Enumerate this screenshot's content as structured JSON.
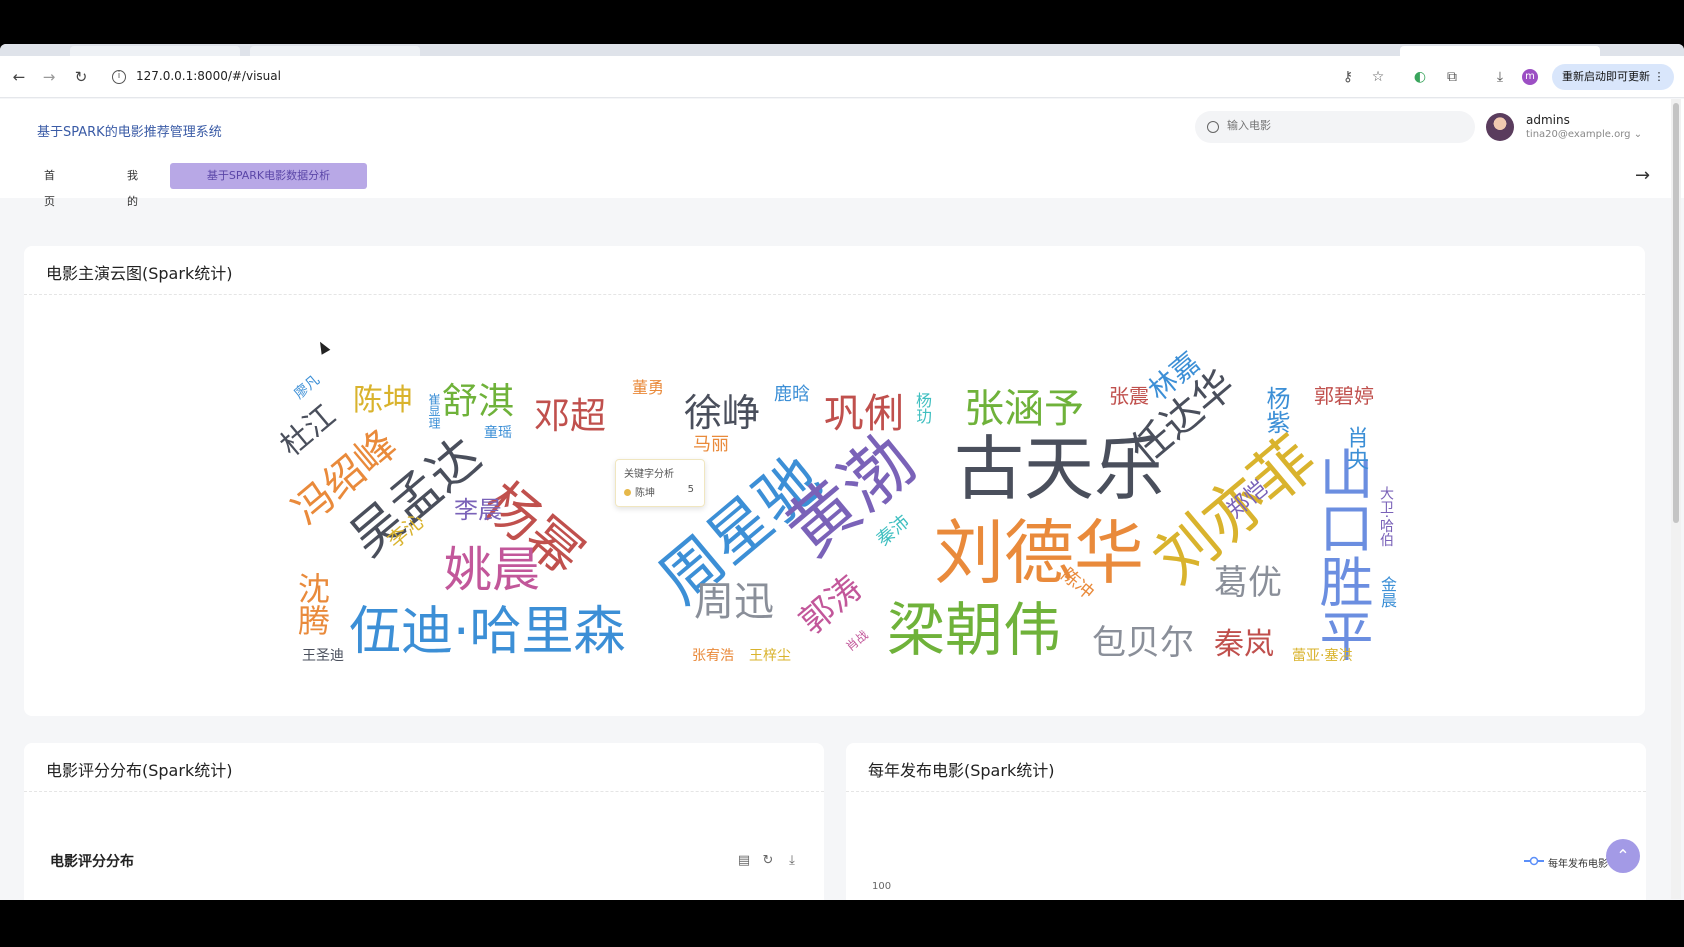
{
  "browser": {
    "url": "127.0.0.1:8000/#/visual",
    "update_label": "重新启动即可更新",
    "profile_initial": "m"
  },
  "app": {
    "title": "基于SPARK的电影推荐管理系统",
    "search_placeholder": "输入电影",
    "user": {
      "name": "admins",
      "email": "tina20@example.org"
    },
    "tabs": [
      {
        "label": "首页"
      },
      {
        "label": "我的"
      },
      {
        "label": "基于SPARK电影数据分析",
        "active": true
      }
    ]
  },
  "cloud_card": {
    "title": "电影主演云图(Spark统计)",
    "words": [
      {
        "text": "古天乐",
        "color": "#4a4f5c"
      },
      {
        "text": "刘德华",
        "color": "#e98a3b"
      },
      {
        "text": "梁朝伟",
        "color": "#6fb23a"
      },
      {
        "text": "周星驰",
        "color": "#3c8fd6"
      },
      {
        "text": "黄渤",
        "color": "#7a62b8"
      },
      {
        "text": "刘亦菲",
        "color": "#d9b32d"
      },
      {
        "text": "山口胜平",
        "color": "#6b8ee0"
      },
      {
        "text": "伍迪·哈里森",
        "color": "#3c8fd6"
      },
      {
        "text": "吴孟达",
        "color": "#4a4f5c"
      },
      {
        "text": "杨幂",
        "color": "#c0504d"
      },
      {
        "text": "姚晨",
        "color": "#c2579a"
      },
      {
        "text": "冯绍峰",
        "color": "#e98a3b"
      },
      {
        "text": "任达华",
        "color": "#4a4f5c"
      },
      {
        "text": "张涵予",
        "color": "#6fb23a"
      },
      {
        "text": "巩俐",
        "color": "#c0504d"
      },
      {
        "text": "徐峥",
        "color": "#4a4f5c"
      },
      {
        "text": "邓超",
        "color": "#c0504d"
      },
      {
        "text": "舒淇",
        "color": "#6fb23a"
      },
      {
        "text": "陈坤",
        "color": "#d9b32d"
      },
      {
        "text": "杜江",
        "color": "#4a4f5c"
      },
      {
        "text": "周迅",
        "color": "#8a8f99"
      },
      {
        "text": "郭涛",
        "color": "#c2579a"
      },
      {
        "text": "葛优",
        "color": "#8a8f99"
      },
      {
        "text": "包贝尔",
        "color": "#8a8f99"
      },
      {
        "text": "秦岚",
        "color": "#c0504d"
      },
      {
        "text": "沈腾",
        "color": "#e98a3b"
      },
      {
        "text": "李晨",
        "color": "#7a62b8"
      },
      {
        "text": "李沁",
        "color": "#d9b32d"
      },
      {
        "text": "郑恺",
        "color": "#7a62b8"
      },
      {
        "text": "林嘉",
        "color": "#3c8fd6"
      },
      {
        "text": "杨紫",
        "color": "#3c8fd6"
      },
      {
        "text": "郭碧婷",
        "color": "#c0504d"
      },
      {
        "text": "肖央",
        "color": "#3c8fd6"
      },
      {
        "text": "张震",
        "color": "#c0504d"
      },
      {
        "text": "鹿晗",
        "color": "#3c8fd6"
      },
      {
        "text": "杨玏",
        "color": "#3fbfc0"
      },
      {
        "text": "秦沛",
        "color": "#3fbfc0"
      },
      {
        "text": "陈冲",
        "color": "#e98a3b"
      },
      {
        "text": "董勇",
        "color": "#e98a3b"
      },
      {
        "text": "马丽",
        "color": "#e98a3b"
      },
      {
        "text": "童瑶",
        "color": "#3c8fd6"
      },
      {
        "text": "廖凡",
        "color": "#3c8fd6"
      },
      {
        "text": "崔显理",
        "color": "#3c8fd6"
      },
      {
        "text": "王圣迪",
        "color": "#4a4f5c"
      },
      {
        "text": "张宥浩",
        "color": "#e98a3b"
      },
      {
        "text": "王梓尘",
        "color": "#d9b32d"
      },
      {
        "text": "肖战",
        "color": "#c2579a"
      },
      {
        "text": "蕾亚·塞洪",
        "color": "#d9b32d"
      },
      {
        "text": "金晨",
        "color": "#3c8fd6"
      },
      {
        "text": "大卫·哈伯",
        "color": "#7a62b8"
      }
    ],
    "tooltip": {
      "series": "关键字分析",
      "name": "陈坤",
      "value": "5"
    }
  },
  "rating_card": {
    "title": "电影评分分布(Spark统计)",
    "chart_title": "电影评分分布"
  },
  "yearly_card": {
    "title": "每年发布电影(Spark统计)",
    "legend": "每年发布电影",
    "y_tick": "100"
  }
}
